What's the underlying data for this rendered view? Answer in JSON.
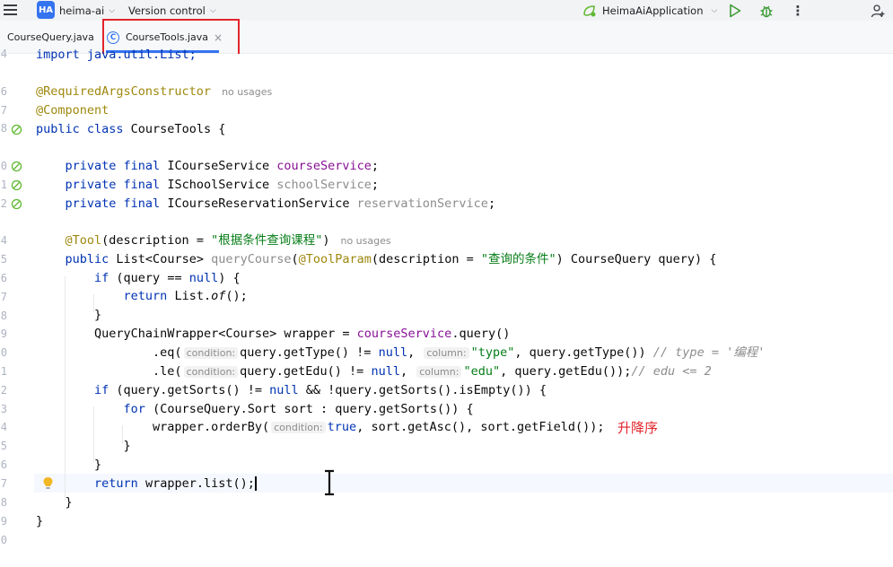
{
  "titlebar": {
    "project_badge": "HA",
    "project_name": "heima-ai",
    "vcs_label": "Version control",
    "run_config": "HeimaAiApplication",
    "more_glyph": "⋮"
  },
  "tabs": [
    {
      "label": "CourseQuery.java",
      "active": false
    },
    {
      "label": "CourseTools.java",
      "active": true,
      "icon_letter": "C",
      "close": "×"
    }
  ],
  "editor": {
    "gutter_numbers": [
      "4",
      "",
      "6",
      "7",
      "8",
      "",
      "0",
      "1",
      "2",
      "",
      "4",
      "5",
      "6",
      "7",
      "8",
      "9",
      "0",
      "1",
      "2",
      "3",
      "4",
      "5",
      "6",
      "7",
      "8",
      "9",
      "0"
    ],
    "lines": {
      "l4": "import java.util.List;",
      "ann1": "@RequiredArgsConstructor",
      "no_usages": "no usages",
      "ann2": "@Component",
      "class_decl_kw": "public class ",
      "class_name": "CourseTools {",
      "pf": "private final ",
      "t1": "ICourseService ",
      "f1": "courseService",
      "t2": "ISchoolService ",
      "f2": "schoolService",
      "t3": "ICourseReservationService ",
      "f3": "reservationService",
      "semi": ";",
      "tool_ann": "@Tool",
      "tool_desc_pre": "(description = ",
      "tool_desc": "\"根据条件查询课程\"",
      "tool_close": ")",
      "pub": "public ",
      "list_course": "List<Course> ",
      "method_name": "queryCourse",
      "paren_open": "(",
      "toolparam_ann": "@ToolParam",
      "param_desc": "\"查询的条件\"",
      "param_rest": ") CourseQuery query) {",
      "if": "if ",
      "if_null": "(query == ",
      "null": "null",
      "brace_open": ") {",
      "return": "return ",
      "list_of_pre": "List.",
      "list_of": "of",
      "list_of_post": "();",
      "close_brace": "}",
      "wrapper_decl": "QueryChainWrapper<Course> wrapper = ",
      "course_service": "courseService",
      "query_call": ".query()",
      "eq": ".eq(",
      "hint_condition": "condition:",
      "get_type": "query.getType() != ",
      "comma": ",",
      "hint_column": "column:",
      "type_str": "\"type\"",
      "get_type2": ", query.getType()) ",
      "cmt1": "// type = '编程'",
      "le": ".le(",
      "get_edu": "query.getEdu() != ",
      "edu_str": "\"edu\"",
      "get_edu2": ", query.getEdu());",
      "cmt2": "// edu <= 2",
      "if_sorts": "(query.getSorts() != ",
      "if_sorts2": " && !query.getSorts().isEmpty()) {",
      "for": "for ",
      "for_body": "(CourseQuery.Sort sort : query.getSorts()) {",
      "order_by": "wrapper.orderBy(",
      "true": "true",
      "order_rest": ", sort.getAsc(), sort.getField());",
      "return_list": "wrapper.list();"
    },
    "annotation_note": "升降序"
  },
  "colors": {
    "keyword": "#0033b3",
    "annotation": "#9e880d",
    "field": "#871094",
    "string": "#067d17",
    "comment": "#8c8c8c",
    "accent": "#3574f0",
    "highlight_red": "#e3242b"
  }
}
